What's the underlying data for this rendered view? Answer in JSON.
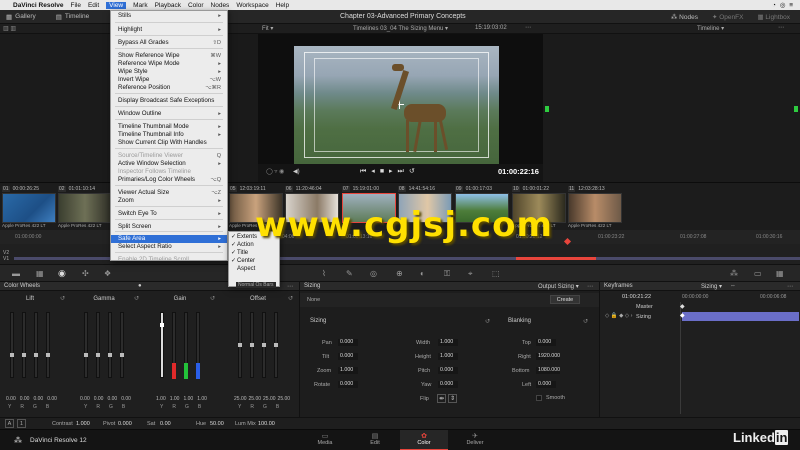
{
  "menubar": {
    "app": "DaVinci Resolve",
    "items": [
      "File",
      "Edit",
      "View",
      "Mark",
      "Playback",
      "Color",
      "Nodes",
      "Workspace",
      "Help"
    ],
    "open_item": "View"
  },
  "toolbar": {
    "gallery": "Gallery",
    "timeline": "Timeline",
    "project_title": "Chapter 03-Advanced Primary Concepts",
    "nodes": "Nodes",
    "openfx": "OpenFX",
    "lightbox": "Lightbox"
  },
  "viewer": {
    "fit": "Fit",
    "timeline_name": "Timelines 03_04 The Sizing Menu",
    "source_tc": "15:19:03:02",
    "timeline_dropdown": "Timeline",
    "timecode": "01:00:22:16"
  },
  "clips": [
    {
      "n": "01",
      "tc": "00:00:26:25",
      "codec": "Apple ProRes 422 LT"
    },
    {
      "n": "02",
      "tc": "01:01:10:14",
      "codec": "Apple ProRes 422 LT"
    },
    {
      "n": "05",
      "tc": "12:03:19:11",
      "codec": ""
    },
    {
      "n": "06",
      "tc": "11:20:46:04",
      "codec": ""
    },
    {
      "n": "07",
      "tc": "15:19:01:00",
      "codec": ""
    },
    {
      "n": "08",
      "tc": "14:41:54:16",
      "codec": ""
    },
    {
      "n": "09",
      "tc": "01:00:17:03",
      "codec": ""
    },
    {
      "n": "10",
      "tc": "01:00:01:22",
      "codec": "Apple ProRes 422 LT"
    },
    {
      "n": "11",
      "tc": "12:03:28:13",
      "codec": "Apple ProRes 422 LT"
    }
  ],
  "clip_partial_codec": "Apple ProRes 422 LT",
  "ruler": {
    "labels": [
      "01:00:00:00",
      "01:00:04:06",
      "01:00:13:10",
      "01:00:20:12",
      "01:00:23:22",
      "01:00:27:08",
      "01:00:30:16"
    ],
    "track_v2": "V2",
    "track_v1": "V1"
  },
  "view_menu": {
    "items": [
      {
        "label": "Stills",
        "sub": true
      },
      {
        "label": "Highlight",
        "sub": true
      },
      {
        "label": "Bypass All Grades",
        "shortcut": "⇧D"
      },
      {
        "label": "Show Reference Wipe",
        "shortcut": "⌘W"
      },
      {
        "label": "Reference Wipe Mode",
        "sub": true
      },
      {
        "label": "Wipe Style",
        "sub": true
      },
      {
        "label": "Invert Wipe",
        "shortcut": "⌥W"
      },
      {
        "label": "Reference Position",
        "shortcut": "⌥⌘R"
      },
      {
        "label": "Display Broadcast Safe Exceptions"
      },
      {
        "label": "Window Outline",
        "sub": true
      },
      {
        "label": "Timeline Thumbnail Mode",
        "sub": true
      },
      {
        "label": "Timeline Thumbnail Info",
        "sub": true
      },
      {
        "label": "Show Current Clip With Handles"
      },
      {
        "label": "Source/Timeline Viewer",
        "shortcut": "Q",
        "disabled": true
      },
      {
        "label": "Active Window Selection",
        "sub": true
      },
      {
        "label": "Inspector Follows Timeline",
        "disabled": true
      },
      {
        "label": "Primaries/Log Color Wheels",
        "shortcut": "⌥Q"
      },
      {
        "label": "Viewer Actual Size",
        "shortcut": "⌥Z"
      },
      {
        "label": "Zoom",
        "sub": true
      },
      {
        "label": "Switch Eye To",
        "sub": true
      },
      {
        "label": "Split Screen",
        "sub": true
      },
      {
        "label": "Safe Area",
        "sub": true,
        "highlighted": true
      },
      {
        "label": "Select Aspect Ratio",
        "sub": true
      },
      {
        "label": "Enable 2D Timeline Scroll",
        "disabled": true
      }
    ]
  },
  "safe_area_menu": {
    "items": [
      {
        "label": "Extents",
        "checked": true
      },
      {
        "label": "Action",
        "checked": true
      },
      {
        "label": "Title",
        "checked": true
      },
      {
        "label": "Center",
        "checked": true
      },
      {
        "label": "Aspect",
        "checked": false
      }
    ],
    "truncated_label": "Normal Os Bars"
  },
  "color_wheels": {
    "title": "Color Wheels",
    "wheels": [
      {
        "name": "Lift",
        "values": [
          "0.00",
          "0.00",
          "0.00",
          "0.00"
        ]
      },
      {
        "name": "Gamma",
        "values": [
          "0.00",
          "0.00",
          "0.00",
          "0.00"
        ]
      },
      {
        "name": "Gain",
        "values": [
          "1.00",
          "1.00",
          "1.00",
          "1.00"
        ]
      },
      {
        "name": "Offset",
        "values": [
          "25.00",
          "25.00",
          "25.00",
          "25.00"
        ]
      }
    ],
    "channels": [
      "Y",
      "R",
      "G",
      "B"
    ]
  },
  "sizing": {
    "title": "Sizing",
    "output_label": "Output Sizing",
    "none_label": "None",
    "create_label": "Create",
    "sizing_section": "Sizing",
    "blanking_section": "Blanking",
    "fields_left": [
      {
        "label": "Pan",
        "value": "0.000"
      },
      {
        "label": "Tilt",
        "value": "0.000"
      },
      {
        "label": "Zoom",
        "value": "1.000"
      },
      {
        "label": "Rotate",
        "value": "0.000"
      }
    ],
    "fields_mid": [
      {
        "label": "Width",
        "value": "1.000"
      },
      {
        "label": "Height",
        "value": "1.000"
      },
      {
        "label": "Pitch",
        "value": "0.000"
      },
      {
        "label": "Yaw",
        "value": "0.000"
      },
      {
        "label": "Flip",
        "value": ""
      }
    ],
    "fields_right": [
      {
        "label": "Top",
        "value": "0.000"
      },
      {
        "label": "Right",
        "value": "1920.000"
      },
      {
        "label": "Bottom",
        "value": "1080.000"
      },
      {
        "label": "Left",
        "value": "0.000"
      }
    ],
    "smooth_label": "Smooth"
  },
  "keyframes": {
    "title": "Keyframes",
    "mode": "Sizing",
    "tc": "01:00:21:22",
    "tc_start": "00:00:00:00",
    "tc_end": "00:00:06:08",
    "master": "Master",
    "track": "Sizing"
  },
  "bottombar": {
    "contrast_label": "Contrast",
    "contrast": "1.000",
    "pivot_label": "Pivot",
    "pivot": "0.000",
    "sat_label": "Sat",
    "sat": "0.00",
    "hue_label": "Hue",
    "hue": "50.00",
    "lummix_label": "Lum Mix",
    "lummix": "100.00",
    "page_a": "A",
    "page_1": "1"
  },
  "pagebar": {
    "app_label": "DaVinci Resolve 12",
    "pages": [
      "Media",
      "Edit",
      "Color",
      "Deliver"
    ],
    "active": "Color"
  },
  "watermark": "www.cgjsj.com",
  "brand": "LinkedIn",
  "colors": {
    "menu_highlight": "#2f6fd6",
    "active_page": "#e8453c",
    "playhead": "#e8453c",
    "keyframe_track": "#6a6ec8",
    "watermark": "#ffe000"
  }
}
